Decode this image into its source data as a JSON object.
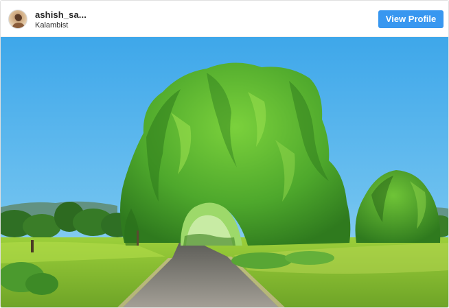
{
  "profile": {
    "username": "ashish_sa...",
    "location": "Kalambist",
    "view_profile_label": "View Profile"
  },
  "media": {
    "type": "photo",
    "subject": "vine-covered tree arch over road"
  },
  "colors": {
    "button": "#3897f0",
    "sky": "#5ab6ec",
    "foliage": "#4ea82c",
    "road": "#8c8a84"
  }
}
